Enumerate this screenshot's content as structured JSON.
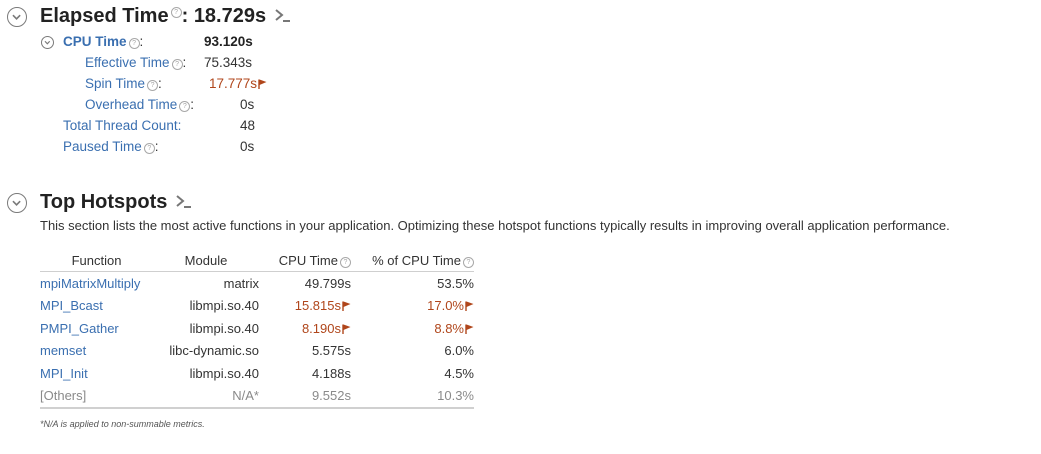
{
  "elapsed": {
    "label": "Elapsed Time",
    "separator": ":",
    "value": "18.729s"
  },
  "metrics": {
    "cpu_time": {
      "label": "CPU Time",
      "colon": ":",
      "value": "93.120s"
    },
    "effective_time": {
      "label": "Effective Time",
      "colon": ":",
      "value": "75.343s"
    },
    "spin_time": {
      "label": "Spin Time",
      "colon": ":",
      "value": "17.777s"
    },
    "overhead_time": {
      "label": "Overhead Time",
      "colon": ":",
      "value": "0s"
    },
    "total_thread_count": {
      "label": "Total Thread Count:",
      "value": "48"
    },
    "paused_time": {
      "label": "Paused Time",
      "colon": ":",
      "value": "0s"
    }
  },
  "hotspots": {
    "title": "Top Hotspots",
    "description": "This section lists the most active functions in your application. Optimizing these hotspot functions typically results in improving overall application performance.",
    "columns": {
      "function": "Function",
      "module": "Module",
      "cpu_time": "CPU Time",
      "pct_cpu_time": "% of CPU Time"
    },
    "rows": [
      {
        "function": "mpiMatrixMultiply",
        "module": "matrix",
        "cpu_time": "49.799s",
        "pct": "53.5%"
      },
      {
        "function": "MPI_Bcast",
        "module": "libmpi.so.40",
        "cpu_time": "15.815s",
        "pct": "17.0%"
      },
      {
        "function": "PMPI_Gather",
        "module": "libmpi.so.40",
        "cpu_time": "8.190s",
        "pct": "8.8%"
      },
      {
        "function": "memset",
        "module": "libc-dynamic.so",
        "cpu_time": "5.575s",
        "pct": "6.0%"
      },
      {
        "function": "MPI_Init",
        "module": "libmpi.so.40",
        "cpu_time": "4.188s",
        "pct": "4.5%"
      },
      {
        "function": "[Others]",
        "module": "N/A*",
        "cpu_time": "9.552s",
        "pct": "10.3%"
      }
    ],
    "footnote": "*N/A is applied to non-summable metrics."
  },
  "icons": {
    "help": "question-circle-icon",
    "flag": "warning-flag-icon",
    "terminal": "terminal-prompt-icon",
    "collapse": "chevron-up-circle-icon"
  },
  "colors": {
    "link": "#3a6fb0",
    "warning": "#b0461b",
    "muted": "#8a8a8a"
  }
}
